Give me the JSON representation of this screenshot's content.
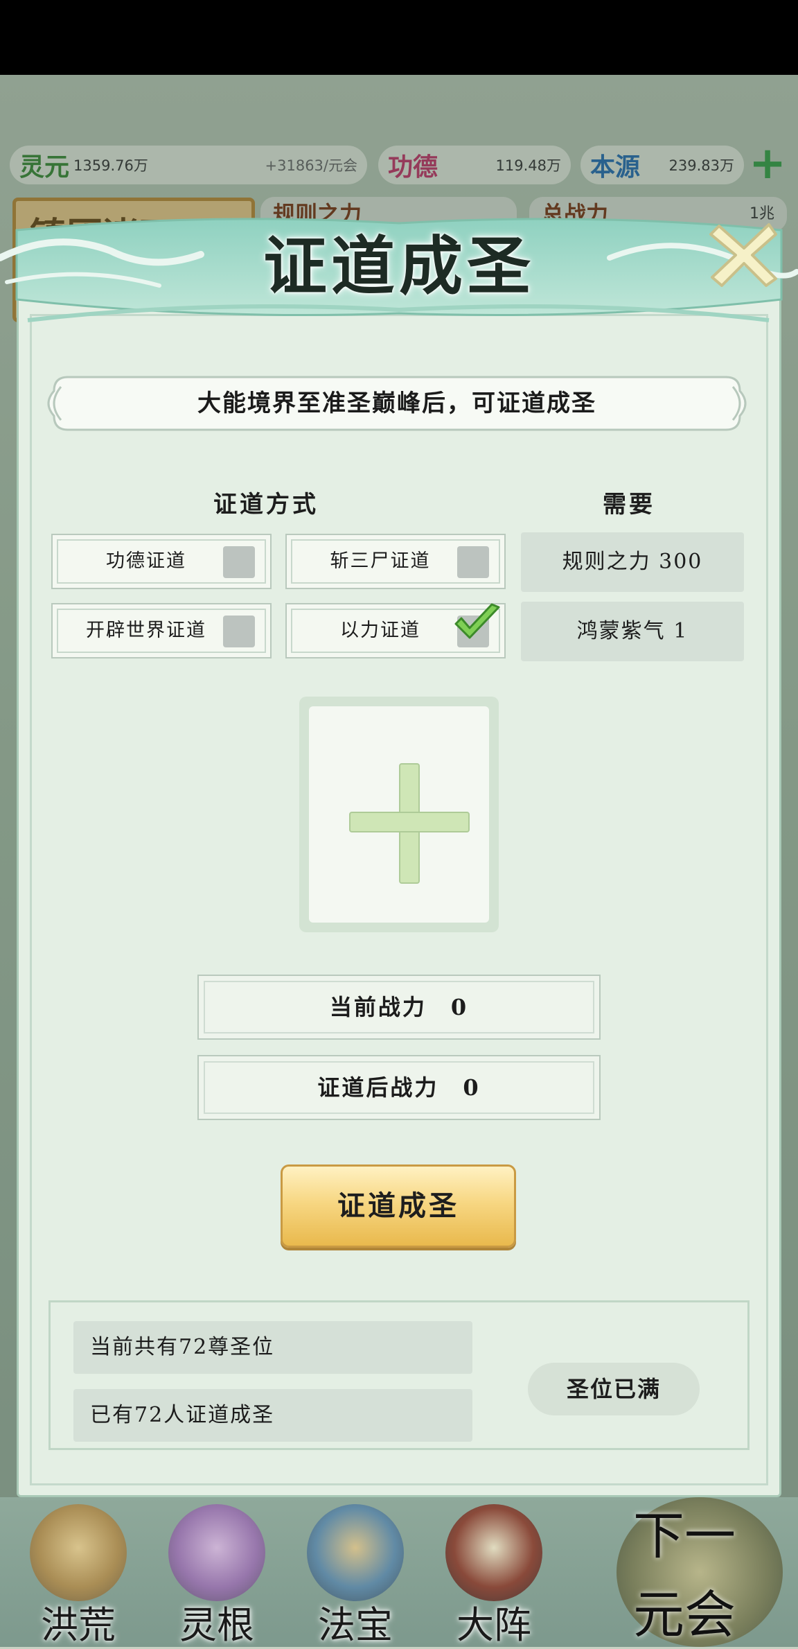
{
  "resources": {
    "lingyuan": {
      "name": "灵元",
      "value": "1359.76万",
      "rate": "+31863/元会"
    },
    "gongde": {
      "name": "功德",
      "value": "119.48万"
    },
    "benyuan": {
      "name": "本源",
      "value": "239.83万"
    }
  },
  "background": {
    "left_tab": "镇压诸天",
    "rules_power": "规则之力",
    "total_power": "总战力",
    "total_power_value": "1兆"
  },
  "modal": {
    "title": "证道成圣",
    "notice": "大能境界至准圣巅峰后，可证道成圣",
    "methods_header": "证道方式",
    "requirements_header": "需要",
    "methods": [
      {
        "label": "功德证道",
        "checked": false
      },
      {
        "label": "斩三尸证道",
        "checked": false
      },
      {
        "label": "开辟世界证道",
        "checked": false
      },
      {
        "label": "以力证道",
        "checked": true
      }
    ],
    "requirements": [
      {
        "label": "规则之力 300"
      },
      {
        "label": "鸿蒙紫气 1"
      }
    ],
    "current_power": "当前战力　0",
    "after_power": "证道后战力　0",
    "action_button": "证道成圣",
    "footer": {
      "seats_total": "当前共有72尊圣位",
      "seats_taken": "已有72人证道成圣",
      "status": "圣位已满"
    }
  },
  "nav": {
    "items": [
      "洪荒",
      "灵根",
      "法宝",
      "大阵"
    ],
    "next_era_line1": "下一",
    "next_era_line2": "元会"
  },
  "colors": {
    "accent_gold": "#f7d783",
    "modal_bg": "#e4efe4",
    "check_green": "#6fbf4a",
    "resource_green": "#3aa04a"
  }
}
